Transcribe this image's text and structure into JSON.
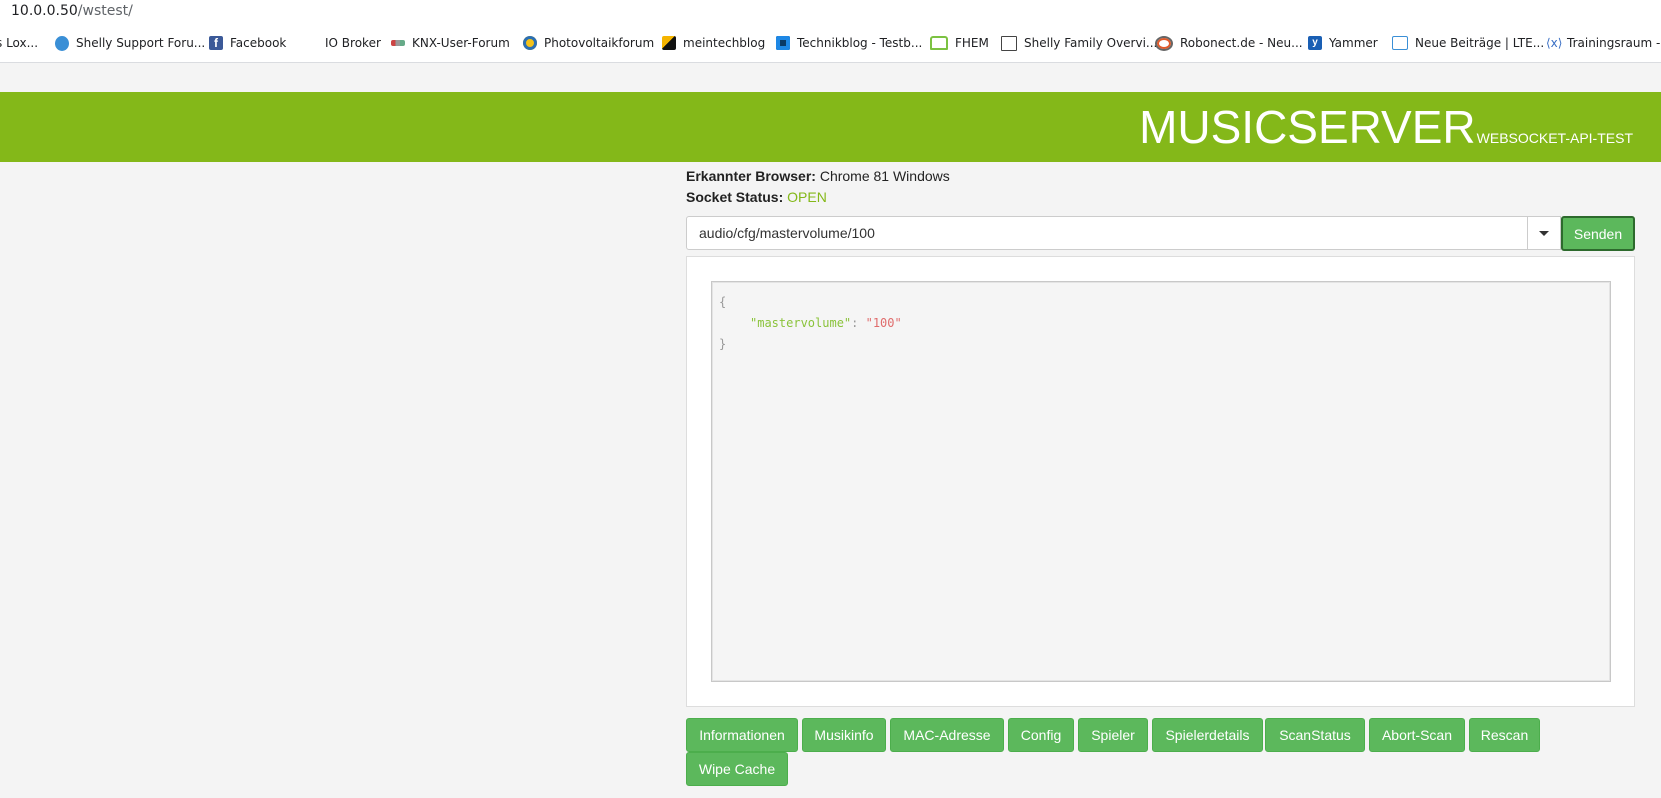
{
  "browser": {
    "url_host": "10.0.0.50",
    "url_path": "/wstest/",
    "bookmarks": [
      {
        "label": "s Lox...",
        "icon": "partial-icon"
      },
      {
        "label": "Shelly Support Foru...",
        "icon": "shelly-icon"
      },
      {
        "label": "Facebook",
        "icon": "facebook-icon"
      },
      {
        "label": "IO Broker",
        "icon": "blank-icon"
      },
      {
        "label": "KNX-User-Forum",
        "icon": "knx-icon"
      },
      {
        "label": "Photovoltaikforum",
        "icon": "pv-icon"
      },
      {
        "label": "meintechblog",
        "icon": "meintechblog-icon"
      },
      {
        "label": "Technikblog - Testb...",
        "icon": "technikblog-icon"
      },
      {
        "label": "FHEM",
        "icon": "fhem-icon"
      },
      {
        "label": "Shelly Family Overvi...",
        "icon": "document-icon"
      },
      {
        "label": "Robonect.de - Neu...",
        "icon": "robonect-icon"
      },
      {
        "label": "Yammer",
        "icon": "yammer-icon"
      },
      {
        "label": "Neue Beiträge | LTE...",
        "icon": "lte-icon"
      },
      {
        "label": "Trainingsraum - S",
        "icon": "training-icon"
      }
    ]
  },
  "header": {
    "title": "MUSICSERVER",
    "subtitle": "WEBSOCKET-API-TEST"
  },
  "info": {
    "browser_label": "Erkannter Browser:",
    "browser_value": "Chrome 81 Windows",
    "status_label": "Socket Status:",
    "status_value": "OPEN"
  },
  "command": {
    "value": "audio/cfg/mastervolume/100",
    "send_label": "Senden"
  },
  "output": {
    "open_brace": "{",
    "key": "\"mastervolume\"",
    "colon": ": ",
    "value": "\"100\"",
    "close_brace": "}"
  },
  "actions": {
    "informationen": "Informationen",
    "musikinfo": "Musikinfo",
    "mac": "MAC-Adresse",
    "config": "Config",
    "spieler": "Spieler",
    "spielerdetails": "Spielerdetails",
    "scanstatus": "ScanStatus",
    "abortscan": "Abort-Scan",
    "rescan": "Rescan",
    "wipecache": "Wipe Cache"
  },
  "colors": {
    "header_green": "#84b819",
    "button_green": "#5cb85c",
    "status_open": "#84b819"
  }
}
